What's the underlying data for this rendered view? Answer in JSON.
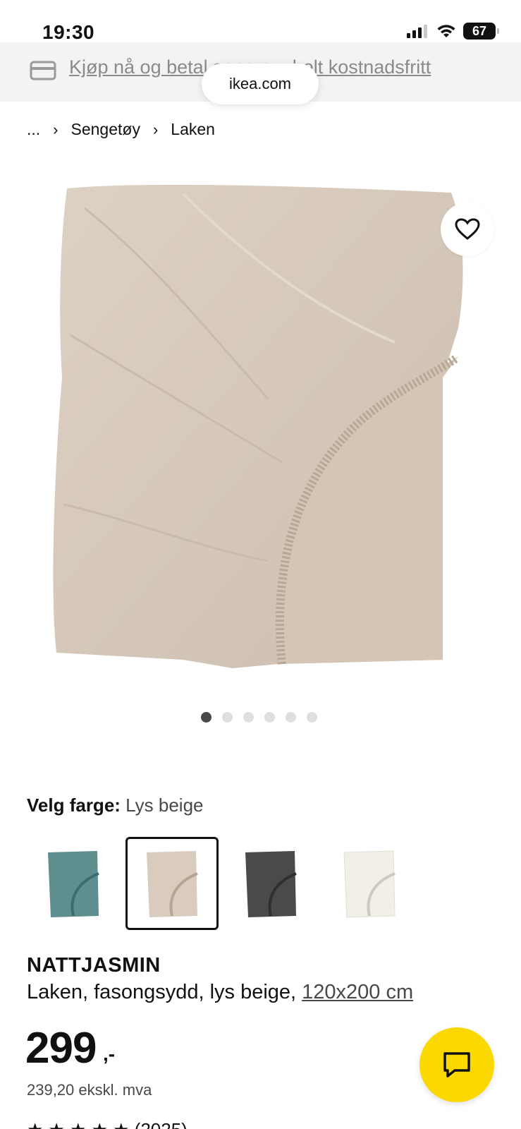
{
  "status_bar": {
    "time": "19:30",
    "battery": "67"
  },
  "promo": {
    "text": "Kjøp nå og betal senere – helt kostnadsfritt"
  },
  "browser": {
    "url": "ikea.com"
  },
  "breadcrumb": {
    "ellipsis": "...",
    "items": [
      "Sengetøy",
      "Laken"
    ]
  },
  "gallery": {
    "image_count": 6,
    "active_index": 0
  },
  "color_selector": {
    "label": "Velg farge:",
    "selected": "Lys beige",
    "swatch_colors": [
      "#5f8e8f",
      "#d9cbbd",
      "#4a4a4c",
      "#f1efe8"
    ],
    "selected_index": 1
  },
  "product": {
    "name": "NATTJASMIN",
    "description": "Laken, fasongsydd, lys beige, ",
    "size": "120x200 cm",
    "price": "299",
    "price_suffix": ",-",
    "price_ex_vat": "239,20 ekskl. mva",
    "rating_count": "(2025)"
  },
  "colors": {
    "chat_button": "#fad800",
    "promo_bg": "#f3f3f3",
    "sheet": "#d7cabd"
  }
}
